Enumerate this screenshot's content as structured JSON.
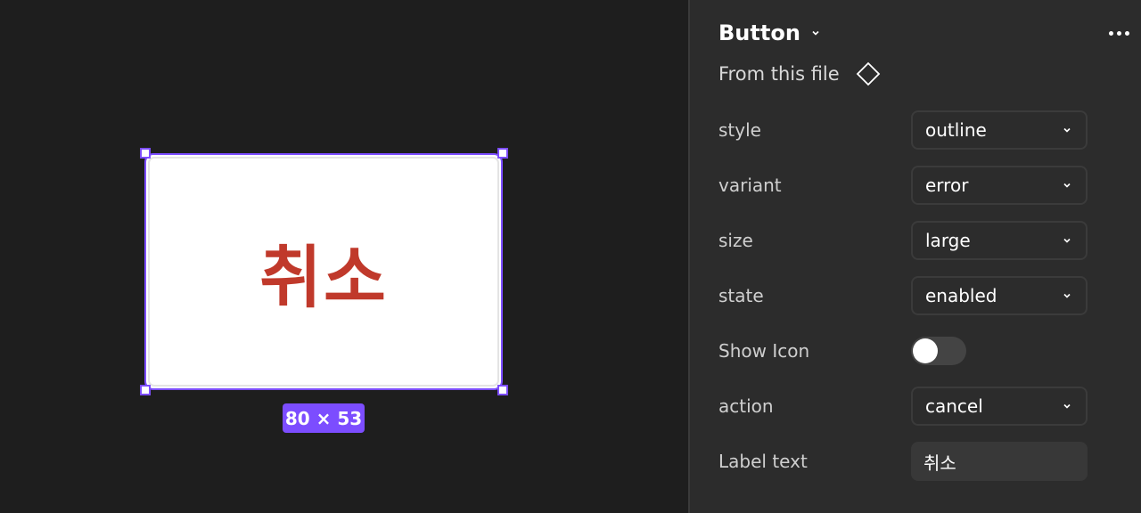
{
  "canvas": {
    "button_label": "취소",
    "size_badge": "80 × 53"
  },
  "panel": {
    "title": "Button",
    "source": "From this file",
    "properties": {
      "style": {
        "label": "style",
        "value": "outline"
      },
      "variant": {
        "label": "variant",
        "value": "error"
      },
      "size": {
        "label": "size",
        "value": "large"
      },
      "state": {
        "label": "state",
        "value": "enabled"
      },
      "show_icon": {
        "label": "Show Icon",
        "enabled": false
      },
      "action": {
        "label": "action",
        "value": "cancel"
      },
      "label_text": {
        "label": "Label text",
        "value": "취소"
      }
    }
  },
  "colors": {
    "selection": "#7c4dff",
    "label_error": "#c0392b",
    "panel_bg": "#2c2c2c",
    "canvas_bg": "#1e1e1e"
  },
  "icons": {
    "title_dropdown": "chevron-down-icon",
    "more": "more-horizontal-icon",
    "component": "component-diamond-icon",
    "select": "chevron-down-icon"
  }
}
